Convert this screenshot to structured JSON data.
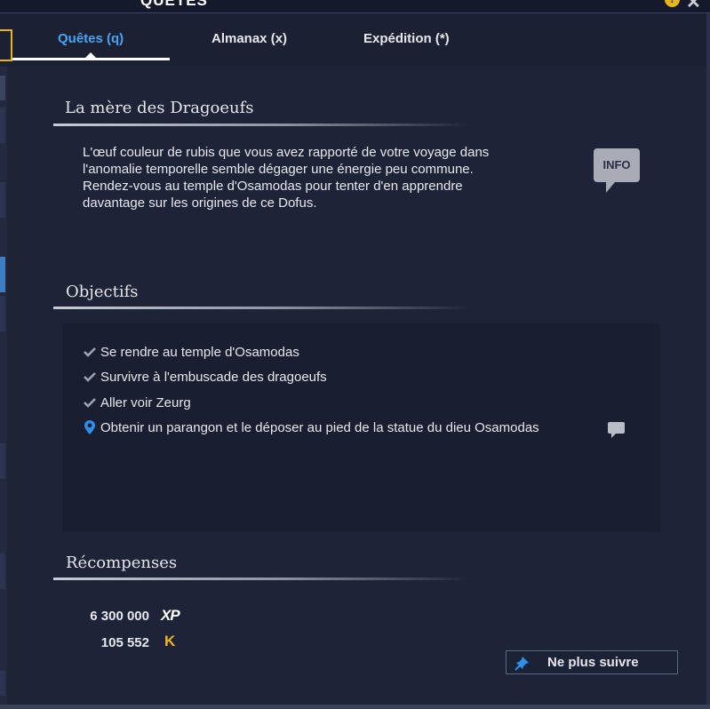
{
  "window": {
    "title": "QUÊTES"
  },
  "tabs": [
    {
      "label": "Quêtes (q)",
      "active": true
    },
    {
      "label": "Almanax (x)",
      "active": false
    },
    {
      "label": "Expédition (*)",
      "active": false
    }
  ],
  "quest": {
    "title": "La mère des Dragoeufs",
    "description_lines": [
      "L'œuf couleur de rubis que vous avez rapporté de votre voyage dans",
      "l'anomalie temporelle semble dégager une énergie peu commune.",
      "Rendez-vous au temple d'Osamodas pour tenter d'en apprendre",
      "davantage sur les origines de ce Dofus."
    ],
    "info_label": "INFO"
  },
  "objectives": {
    "title": "Objectifs",
    "items": [
      {
        "label": "Se rendre au temple d'Osamodas",
        "status": "done"
      },
      {
        "label": "Survivre à l'embuscade des dragoeufs",
        "status": "done"
      },
      {
        "label": "Aller voir Zeurg",
        "status": "done"
      },
      {
        "label": "Obtenir un parangon et le déposer au pied de la statue du dieu Osamodas",
        "status": "current"
      }
    ]
  },
  "rewards": {
    "title": "Récompenses",
    "xp": "6 300 000",
    "xp_icon": "XP",
    "kamas": "105 552",
    "kamas_icon": "K"
  },
  "actions": {
    "unfollow_label": "Ne plus suivre"
  },
  "colors": {
    "background": "#1e2336",
    "accent_tab": "#4aa3f0",
    "gold": "#e7b51d",
    "pin_blue": "#2e8fe8"
  }
}
